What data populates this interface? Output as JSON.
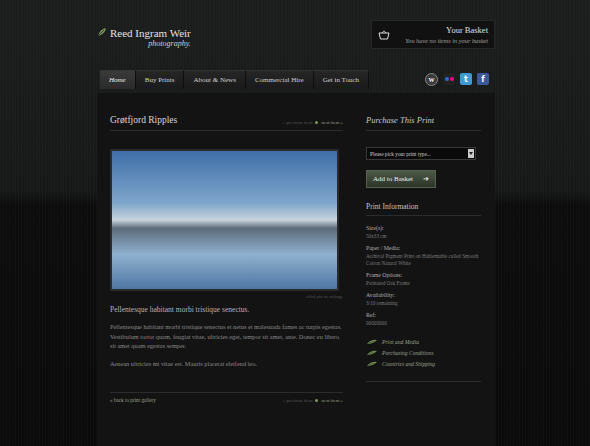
{
  "logo": {
    "name": "Reed Ingram Weir",
    "tagline": "photography."
  },
  "basket": {
    "title": "Your Basket",
    "status": "You have no items in your basket"
  },
  "nav": {
    "tabs": [
      {
        "label": "Home",
        "selected": true
      },
      {
        "label": "Buy Prints",
        "selected": false
      },
      {
        "label": "About & News",
        "selected": false
      },
      {
        "label": "Commercial Hire",
        "selected": false
      },
      {
        "label": "Get in Touch",
        "selected": false
      }
    ]
  },
  "social": [
    {
      "kind": "wordpress",
      "glyph": "W"
    },
    {
      "kind": "flickr",
      "glyph": ""
    },
    {
      "kind": "twitter",
      "glyph": "t"
    },
    {
      "kind": "facebook",
      "glyph": "f"
    }
  ],
  "article": {
    "title": "Grøtfjord Ripples",
    "pager_top": {
      "previous": "« previous item",
      "next": "next item »"
    },
    "caption": "click pic to enlarge",
    "lead": "Pellentesque habitant morbi tristique senectus.",
    "paragraphs": [
      "Pellentesque habitant morbi tristique senectus et netus et malesuada fames ac turpis egestas. Vestibulum tortor quam, feugiat vitae, ultricies eget, tempor sit amet, ante. Donec eu libero sit amet quam egestas semper.",
      "Aenean ultricies mi vitae est. Mauris placerat eleifend leo."
    ],
    "back": "« back to print gallery",
    "pager_bottom": {
      "previous": "« previous item",
      "next": "next item »"
    }
  },
  "purchase": {
    "heading": "Purchase This Print",
    "select_placeholder": "Please pick your print type...",
    "button": "Add to Basket",
    "button_arrow": "➔"
  },
  "info": {
    "heading": "Print Information",
    "fields": [
      {
        "label": "Size(s):",
        "value": "50x33 cm"
      },
      {
        "label": "Paper / Media:",
        "value": "Archival Pigment Print on Hahlemuhle called Smooth Cotton Natural White"
      },
      {
        "label": "Frame Options:",
        "value": "Patinated Oak Frame"
      },
      {
        "label": "Availability:",
        "value": "3/10 remaining"
      },
      {
        "label": "Ref:",
        "value": "00000000"
      }
    ],
    "links": [
      "Print and Media",
      "Purchasing Conditions",
      "Countries and Shipping"
    ]
  }
}
